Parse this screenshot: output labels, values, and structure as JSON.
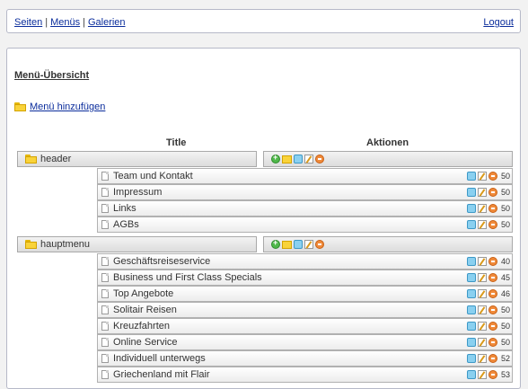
{
  "nav": {
    "links": [
      "Seiten",
      "Menüs",
      "Galerien"
    ],
    "separator": "|",
    "logout": "Logout"
  },
  "page": {
    "heading": "Menü-Übersicht",
    "add_menu": "Menü hinzufügen"
  },
  "table": {
    "col_title": "Title",
    "col_actions": "Aktionen"
  },
  "menus": [
    {
      "name": "header",
      "items": [
        {
          "label": "Team und Kontakt",
          "num": "50"
        },
        {
          "label": "Impressum",
          "num": "50"
        },
        {
          "label": "Links",
          "num": "50"
        },
        {
          "label": "AGBs",
          "num": "50"
        }
      ]
    },
    {
      "name": "hauptmenu",
      "items": [
        {
          "label": "Geschäftsreiseservice",
          "num": "40"
        },
        {
          "label": "Business und First Class Specials",
          "num": "45"
        },
        {
          "label": "Top Angebote",
          "num": "46"
        },
        {
          "label": "Solitair Reisen",
          "num": "50"
        },
        {
          "label": "Kreuzfahrten",
          "num": "50"
        },
        {
          "label": "Online Service",
          "num": "50"
        },
        {
          "label": "Individuell unterwegs",
          "num": "52"
        },
        {
          "label": "Griechenland mit Flair",
          "num": "53"
        }
      ]
    }
  ],
  "icons": {
    "menu_actions": [
      "add-icon",
      "folder-icon",
      "view-icon",
      "edit-icon",
      "delete-icon"
    ],
    "item_actions": [
      "view-icon",
      "edit-icon",
      "delete-icon"
    ]
  },
  "colors": {
    "link": "#0b2d9c",
    "add": "#4fb84a",
    "delete": "#f08a3a",
    "view": "#8ad0f0",
    "folder": "#f9d33a"
  }
}
